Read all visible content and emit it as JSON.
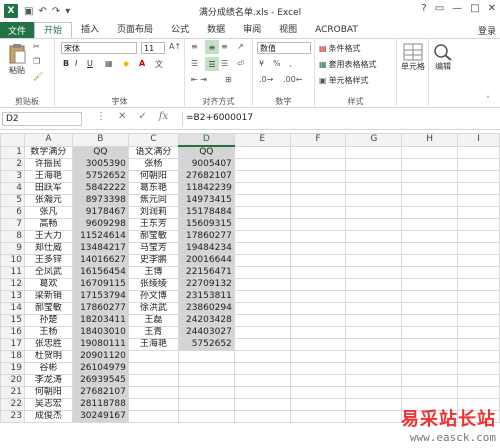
{
  "window": {
    "title": "满分成绩名单.xls - Excel",
    "app_logo": "X",
    "controls": [
      "?",
      "▭",
      "—",
      "□",
      "✕"
    ]
  },
  "tabs": [
    {
      "label": "文件",
      "active": false
    },
    {
      "label": "开始",
      "active": true
    },
    {
      "label": "插入",
      "active": false
    },
    {
      "label": "页面布局",
      "active": false
    },
    {
      "label": "公式",
      "active": false
    },
    {
      "label": "数据",
      "active": false
    },
    {
      "label": "审阅",
      "active": false
    },
    {
      "label": "视图",
      "active": false
    },
    {
      "label": "ACROBAT",
      "active": false
    }
  ],
  "login": "登录",
  "ribbon": {
    "clipboard": {
      "label": "剪贴板",
      "paste": "粘贴"
    },
    "font": {
      "label": "字体",
      "family": "宋体",
      "size": "11"
    },
    "alignment": {
      "label": "对齐方式"
    },
    "number": {
      "label": "数字",
      "format": "数值"
    },
    "styles": {
      "label": "样式",
      "cond": "条件格式",
      "table": "套用表格格式",
      "cell": "单元格样式"
    },
    "cells": {
      "label": "单元格"
    },
    "editing": {
      "label": "编辑"
    }
  },
  "formula_bar": {
    "name_box": "D2",
    "fx": "fx",
    "formula": "=B2+6000017"
  },
  "columns": [
    "A",
    "B",
    "C",
    "D",
    "E",
    "F",
    "G",
    "H",
    "I"
  ],
  "sheet": {
    "header_row": [
      "数学满分",
      "QQ",
      "语文满分",
      "QQ"
    ],
    "rows": [
      [
        "许振民",
        "3005390",
        "张杨",
        "9005407"
      ],
      [
        "王海艳",
        "5752652",
        "何朝阳",
        "27682107"
      ],
      [
        "田跃军",
        "5842222",
        "葛东艳",
        "11842239"
      ],
      [
        "张瀚元",
        "8973398",
        "焦元同",
        "14973415"
      ],
      [
        "张凡",
        "9178467",
        "刘润莉",
        "15178484"
      ],
      [
        "高畅",
        "9609298",
        "王东芳",
        "15609315"
      ],
      [
        "王大力",
        "11524614",
        "郝莹敏",
        "17860277"
      ],
      [
        "郑仕威",
        "13484217",
        "马莹芳",
        "19484234"
      ],
      [
        "王多锌",
        "14016627",
        "史李鹏",
        "20016644"
      ],
      [
        "仝凤武",
        "16156454",
        "王博",
        "22156471"
      ],
      [
        "葛欢",
        "16709115",
        "张绫绫",
        "22709132"
      ],
      [
        "梁新销",
        "17153794",
        "孙文博",
        "23153811"
      ],
      [
        "郝莹敏",
        "17860277",
        "徐洪武",
        "23860294"
      ],
      [
        "孙楚",
        "18203411",
        "王磊",
        "24203428"
      ],
      [
        "王杨",
        "18403010",
        "王青",
        "24403027"
      ],
      [
        "张忠胜",
        "19080111",
        "王海艳",
        "5752652"
      ],
      [
        "杜贺明",
        "20901120",
        "",
        ""
      ],
      [
        "谷彬",
        "26104979",
        "",
        ""
      ],
      [
        "李龙涛",
        "26939545",
        "",
        ""
      ],
      [
        "何朝阳",
        "27682107",
        "",
        ""
      ],
      [
        "吴志宏",
        "28118788",
        "",
        ""
      ],
      [
        "成俊杰",
        "30249167",
        "",
        ""
      ]
    ]
  },
  "watermark": {
    "name": "易采站长站",
    "url": "www.easck.com"
  },
  "colors": {
    "accent": "#217346",
    "shade": "#d4d4d4"
  }
}
